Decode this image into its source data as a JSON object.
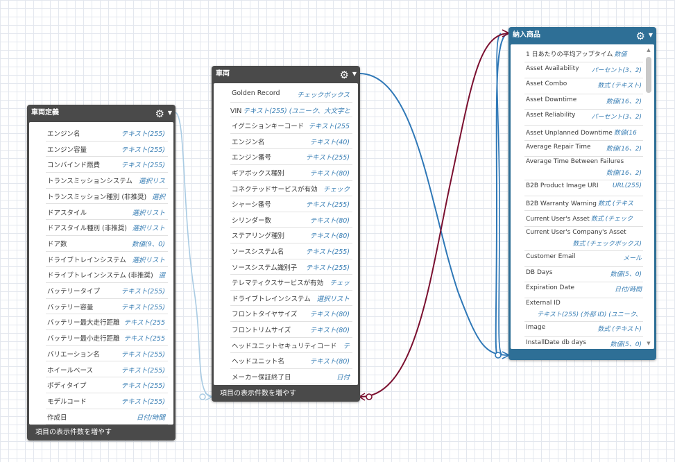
{
  "colors": {
    "dark_card": "#4a4a4a",
    "blue_card": "#2e6f96",
    "link_blue": "#2f78b7",
    "link_red": "#7b1030",
    "type_text": "#3a7fb5"
  },
  "left": {
    "title": "車両定義",
    "footer": "項目の表示件数を増やす",
    "fields": [
      {
        "label": "エンジン名",
        "type": "テキスト(255)"
      },
      {
        "label": "エンジン容量",
        "type": "テキスト(255)"
      },
      {
        "label": "コンバインド燃費",
        "type": "テキスト(255)"
      },
      {
        "label": "トランスミッションシステム",
        "type": "選択リス"
      },
      {
        "label": "トランスミッション種別 (非推奨)",
        "type": "選択"
      },
      {
        "label": "ドアスタイル",
        "type": "選択リスト"
      },
      {
        "label": "ドアスタイル種別 (非推奨)",
        "type": "選択リスト"
      },
      {
        "label": "ドア数",
        "type": "数値(9、0)"
      },
      {
        "label": "ドライブトレインシステム",
        "type": "選択リスト"
      },
      {
        "label": "ドライブトレインシステム (非推奨)",
        "type": "選"
      },
      {
        "label": "バッテリータイプ",
        "type": "テキスト(255)"
      },
      {
        "label": "バッテリー容量",
        "type": "テキスト(255)"
      },
      {
        "label": "バッテリー最大走行距離",
        "type": "テキスト(255"
      },
      {
        "label": "バッテリー最小走行距離",
        "type": "テキスト(255"
      },
      {
        "label": "バリエーション名",
        "type": "テキスト(255)"
      },
      {
        "label": "ホイールベース",
        "type": "テキスト(255)"
      },
      {
        "label": "ボディタイプ",
        "type": "テキスト(255)"
      },
      {
        "label": "モデルコード",
        "type": "テキスト(255)"
      },
      {
        "label": "作成日",
        "type": "日付/時間"
      }
    ]
  },
  "middle": {
    "title": "車両",
    "footer": "項目の表示件数を増やす",
    "fields": [
      {
        "label": "Golden Record",
        "type": "チェックボックス"
      },
      {
        "label": "VIN",
        "type": "テキスト(255) (ユニーク、大文字と"
      },
      {
        "label": "イグニションキーコード",
        "type": "テキスト(255"
      },
      {
        "label": "エンジン名",
        "type": "テキスト(40)"
      },
      {
        "label": "エンジン番号",
        "type": "テキスト(255)"
      },
      {
        "label": "ギアボックス種別",
        "type": "テキスト(80)"
      },
      {
        "label": "コネクテッドサービスが有効",
        "type": "チェック"
      },
      {
        "label": "シャーシ番号",
        "type": "テキスト(255)"
      },
      {
        "label": "シリンダー数",
        "type": "テキスト(80)"
      },
      {
        "label": "ステアリング種別",
        "type": "テキスト(80)"
      },
      {
        "label": "ソースシステム名",
        "type": "テキスト(255)"
      },
      {
        "label": "ソースシステム識別子",
        "type": "テキスト(255)"
      },
      {
        "label": "テレマティクスサービスが有効",
        "type": "チェッ"
      },
      {
        "label": "ドライブトレインシステム",
        "type": "選択リスト"
      },
      {
        "label": "フロントタイヤサイズ",
        "type": "テキスト(80)"
      },
      {
        "label": "フロントリムサイズ",
        "type": "テキスト(80)"
      },
      {
        "label": "ヘッドユニットセキュリティコード",
        "type": "テ"
      },
      {
        "label": "ヘッドユニット名",
        "type": "テキスト(80)"
      },
      {
        "label": "メーカー保証終了日",
        "type": "日付"
      }
    ]
  },
  "right": {
    "title": "納入商品",
    "fields": [
      {
        "label": "1 日あたりの平均アップタイム",
        "type": "数値"
      },
      {
        "label": "Asset Availability",
        "type": "パーセント(3、2)"
      },
      {
        "label": "Asset Combo",
        "type": "数式 (テキスト)"
      },
      {
        "label": "Asset Downtime",
        "type": "数値(16、2)"
      },
      {
        "label": "Asset Reliability",
        "type": "パーセント(3、2)"
      },
      {
        "label": "Asset Unplanned Downtime",
        "type": "数値(16"
      },
      {
        "label": "Average Repair Time",
        "type": "数値(16、2)"
      },
      {
        "label": "Average Time Between Failures",
        "type": "数値(16、2)"
      },
      {
        "label": "B2B Product Image URI",
        "type": "URL(255)"
      },
      {
        "label": "B2B Warranty Warning",
        "type": "数式 (テキス"
      },
      {
        "label": "Current User's Asset",
        "type": "数式 (チェック"
      },
      {
        "label": "Current User's Company's Asset",
        "type": "数式 (チェックボックス)"
      },
      {
        "label": "Customer Email",
        "type": "メール"
      },
      {
        "label": "DB Days",
        "type": "数値(5、0)"
      },
      {
        "label": "Expiration Date",
        "type": "日付/時間"
      },
      {
        "label": "External ID",
        "type": "テキスト(255) (外部 ID) (ユニーク、"
      },
      {
        "label": "Image",
        "type": "数式 (テキスト)"
      },
      {
        "label": "InstallDate db days",
        "type": "数値(5、0)"
      }
    ]
  }
}
